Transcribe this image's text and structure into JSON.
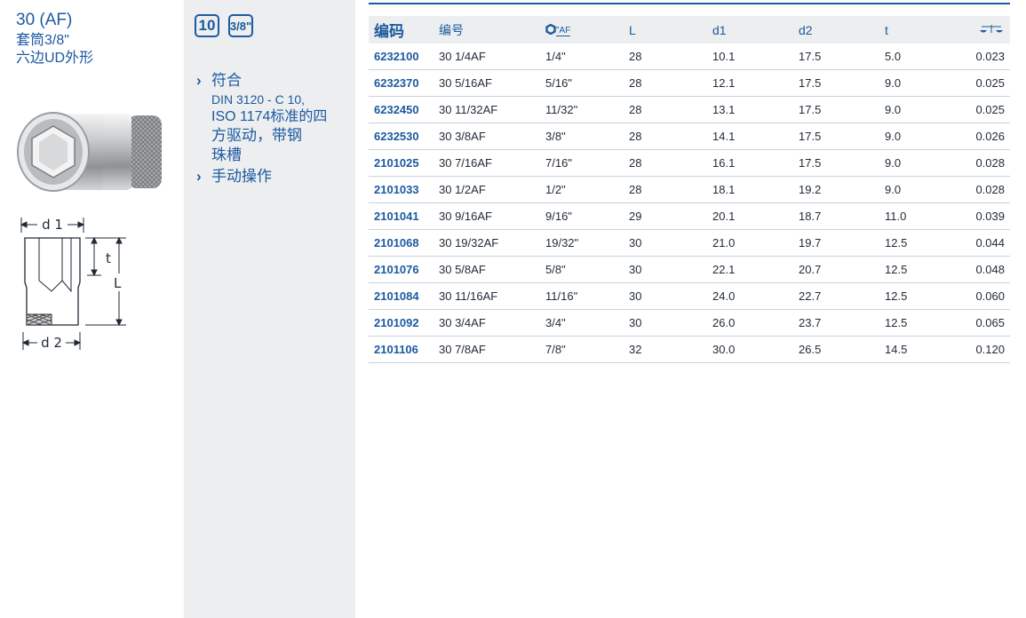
{
  "product": {
    "title": "30 (AF)",
    "subtitle_lines": [
      "套筒3/8\"",
      "六边UD外形"
    ]
  },
  "badges": {
    "size_mm": "10",
    "drive": "3/8\""
  },
  "features": [
    {
      "main": "符合",
      "detail": [
        "DIN 3120 - C 10,",
        "ISO 1174标准的四",
        "方驱动，带钢",
        "珠槽"
      ]
    },
    {
      "main": "手动操作",
      "detail": []
    }
  ],
  "drawing": {
    "label_d1": "d 1",
    "label_d2": "d 2",
    "label_t": "t",
    "label_L": "L"
  },
  "table": {
    "headers": {
      "code": "编码",
      "number": "编号",
      "af": "\"AF",
      "L": "L",
      "d1": "d1",
      "d2": "d2",
      "t": "t"
    },
    "rows": [
      [
        "6232100",
        "30 1/4AF",
        "1/4\"",
        "28",
        "10.1",
        "17.5",
        "5.0",
        "0.023"
      ],
      [
        "6232370",
        "30 5/16AF",
        "5/16\"",
        "28",
        "12.1",
        "17.5",
        "9.0",
        "0.025"
      ],
      [
        "6232450",
        "30 11/32AF",
        "11/32\"",
        "28",
        "13.1",
        "17.5",
        "9.0",
        "0.025"
      ],
      [
        "6232530",
        "30 3/8AF",
        "3/8\"",
        "28",
        "14.1",
        "17.5",
        "9.0",
        "0.026"
      ],
      [
        "2101025",
        "30 7/16AF",
        "7/16\"",
        "28",
        "16.1",
        "17.5",
        "9.0",
        "0.028"
      ],
      [
        "2101033",
        "30 1/2AF",
        "1/2\"",
        "28",
        "18.1",
        "19.2",
        "9.0",
        "0.028"
      ],
      [
        "2101041",
        "30 9/16AF",
        "9/16\"",
        "29",
        "20.1",
        "18.7",
        "11.0",
        "0.039"
      ],
      [
        "2101068",
        "30 19/32AF",
        "19/32\"",
        "30",
        "21.0",
        "19.7",
        "12.5",
        "0.044"
      ],
      [
        "2101076",
        "30 5/8AF",
        "5/8\"",
        "30",
        "22.1",
        "20.7",
        "12.5",
        "0.048"
      ],
      [
        "2101084",
        "30 11/16AF",
        "11/16\"",
        "30",
        "24.0",
        "22.7",
        "12.5",
        "0.060"
      ],
      [
        "2101092",
        "30 3/4AF",
        "3/4\"",
        "30",
        "26.0",
        "23.7",
        "12.5",
        "0.065"
      ],
      [
        "2101106",
        "30 7/8AF",
        "7/8\"",
        "32",
        "30.0",
        "26.5",
        "14.5",
        "0.120"
      ]
    ]
  },
  "colors": {
    "brand_blue": "#1d5aa0",
    "panel_gray": "#eceef0",
    "row_line": "#c9d2dc"
  },
  "icons": {
    "af_header": "hex-socket-icon",
    "weight_header": "scale-icon"
  }
}
